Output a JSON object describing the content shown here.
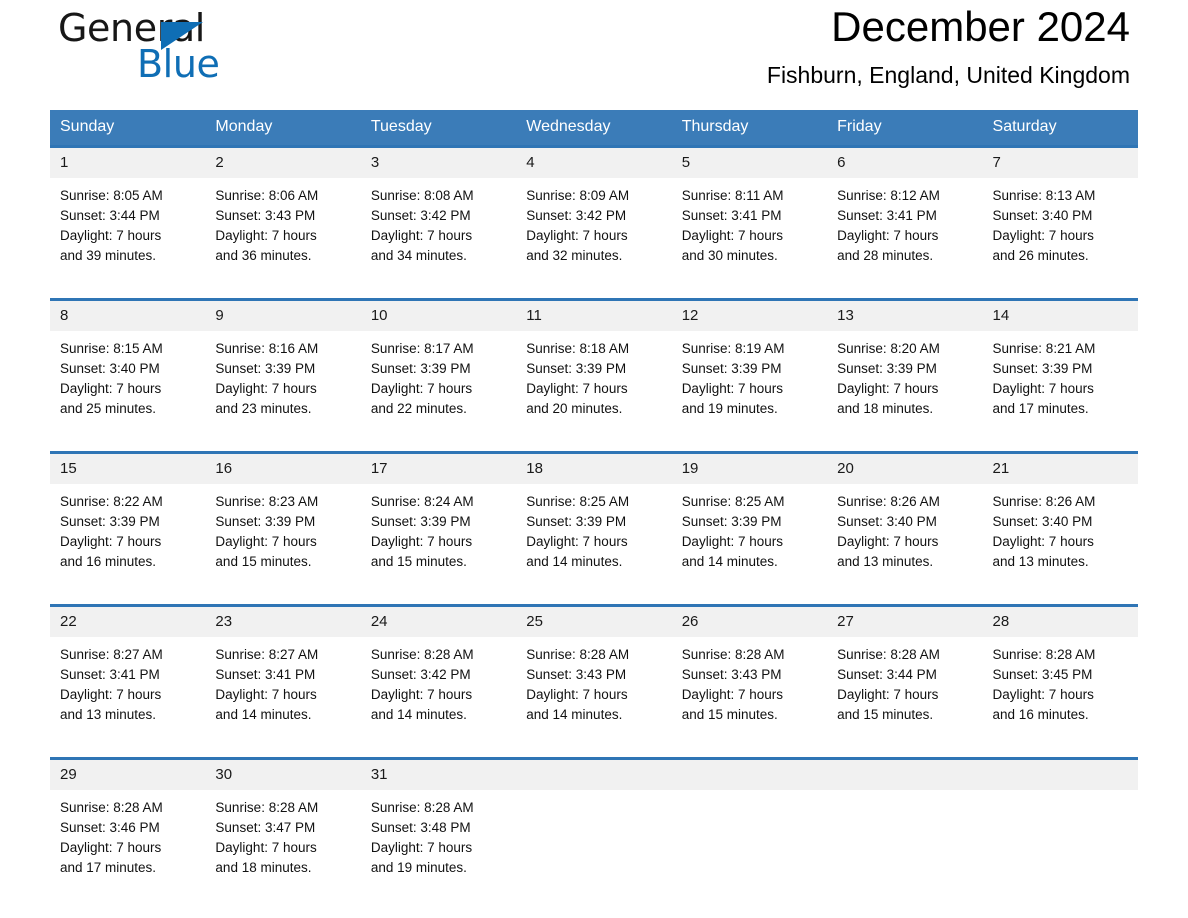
{
  "brand": {
    "name_part1": "General",
    "name_part2": "Blue",
    "accent_color": "#0F6EB5"
  },
  "header": {
    "title": "December 2024",
    "location": "Fishburn, England, United Kingdom",
    "header_bg": "#3B7CB8",
    "row_border_color": "#2F75B5",
    "daynum_bg": "#F1F1F1"
  },
  "weekday_headers": [
    "Sunday",
    "Monday",
    "Tuesday",
    "Wednesday",
    "Thursday",
    "Friday",
    "Saturday"
  ],
  "weeks": [
    [
      {
        "day": "1",
        "sunrise": "Sunrise: 8:05 AM",
        "sunset": "Sunset: 3:44 PM",
        "daylight_1": "Daylight: 7 hours",
        "daylight_2": "and 39 minutes."
      },
      {
        "day": "2",
        "sunrise": "Sunrise: 8:06 AM",
        "sunset": "Sunset: 3:43 PM",
        "daylight_1": "Daylight: 7 hours",
        "daylight_2": "and 36 minutes."
      },
      {
        "day": "3",
        "sunrise": "Sunrise: 8:08 AM",
        "sunset": "Sunset: 3:42 PM",
        "daylight_1": "Daylight: 7 hours",
        "daylight_2": "and 34 minutes."
      },
      {
        "day": "4",
        "sunrise": "Sunrise: 8:09 AM",
        "sunset": "Sunset: 3:42 PM",
        "daylight_1": "Daylight: 7 hours",
        "daylight_2": "and 32 minutes."
      },
      {
        "day": "5",
        "sunrise": "Sunrise: 8:11 AM",
        "sunset": "Sunset: 3:41 PM",
        "daylight_1": "Daylight: 7 hours",
        "daylight_2": "and 30 minutes."
      },
      {
        "day": "6",
        "sunrise": "Sunrise: 8:12 AM",
        "sunset": "Sunset: 3:41 PM",
        "daylight_1": "Daylight: 7 hours",
        "daylight_2": "and 28 minutes."
      },
      {
        "day": "7",
        "sunrise": "Sunrise: 8:13 AM",
        "sunset": "Sunset: 3:40 PM",
        "daylight_1": "Daylight: 7 hours",
        "daylight_2": "and 26 minutes."
      }
    ],
    [
      {
        "day": "8",
        "sunrise": "Sunrise: 8:15 AM",
        "sunset": "Sunset: 3:40 PM",
        "daylight_1": "Daylight: 7 hours",
        "daylight_2": "and 25 minutes."
      },
      {
        "day": "9",
        "sunrise": "Sunrise: 8:16 AM",
        "sunset": "Sunset: 3:39 PM",
        "daylight_1": "Daylight: 7 hours",
        "daylight_2": "and 23 minutes."
      },
      {
        "day": "10",
        "sunrise": "Sunrise: 8:17 AM",
        "sunset": "Sunset: 3:39 PM",
        "daylight_1": "Daylight: 7 hours",
        "daylight_2": "and 22 minutes."
      },
      {
        "day": "11",
        "sunrise": "Sunrise: 8:18 AM",
        "sunset": "Sunset: 3:39 PM",
        "daylight_1": "Daylight: 7 hours",
        "daylight_2": "and 20 minutes."
      },
      {
        "day": "12",
        "sunrise": "Sunrise: 8:19 AM",
        "sunset": "Sunset: 3:39 PM",
        "daylight_1": "Daylight: 7 hours",
        "daylight_2": "and 19 minutes."
      },
      {
        "day": "13",
        "sunrise": "Sunrise: 8:20 AM",
        "sunset": "Sunset: 3:39 PM",
        "daylight_1": "Daylight: 7 hours",
        "daylight_2": "and 18 minutes."
      },
      {
        "day": "14",
        "sunrise": "Sunrise: 8:21 AM",
        "sunset": "Sunset: 3:39 PM",
        "daylight_1": "Daylight: 7 hours",
        "daylight_2": "and 17 minutes."
      }
    ],
    [
      {
        "day": "15",
        "sunrise": "Sunrise: 8:22 AM",
        "sunset": "Sunset: 3:39 PM",
        "daylight_1": "Daylight: 7 hours",
        "daylight_2": "and 16 minutes."
      },
      {
        "day": "16",
        "sunrise": "Sunrise: 8:23 AM",
        "sunset": "Sunset: 3:39 PM",
        "daylight_1": "Daylight: 7 hours",
        "daylight_2": "and 15 minutes."
      },
      {
        "day": "17",
        "sunrise": "Sunrise: 8:24 AM",
        "sunset": "Sunset: 3:39 PM",
        "daylight_1": "Daylight: 7 hours",
        "daylight_2": "and 15 minutes."
      },
      {
        "day": "18",
        "sunrise": "Sunrise: 8:25 AM",
        "sunset": "Sunset: 3:39 PM",
        "daylight_1": "Daylight: 7 hours",
        "daylight_2": "and 14 minutes."
      },
      {
        "day": "19",
        "sunrise": "Sunrise: 8:25 AM",
        "sunset": "Sunset: 3:39 PM",
        "daylight_1": "Daylight: 7 hours",
        "daylight_2": "and 14 minutes."
      },
      {
        "day": "20",
        "sunrise": "Sunrise: 8:26 AM",
        "sunset": "Sunset: 3:40 PM",
        "daylight_1": "Daylight: 7 hours",
        "daylight_2": "and 13 minutes."
      },
      {
        "day": "21",
        "sunrise": "Sunrise: 8:26 AM",
        "sunset": "Sunset: 3:40 PM",
        "daylight_1": "Daylight: 7 hours",
        "daylight_2": "and 13 minutes."
      }
    ],
    [
      {
        "day": "22",
        "sunrise": "Sunrise: 8:27 AM",
        "sunset": "Sunset: 3:41 PM",
        "daylight_1": "Daylight: 7 hours",
        "daylight_2": "and 13 minutes."
      },
      {
        "day": "23",
        "sunrise": "Sunrise: 8:27 AM",
        "sunset": "Sunset: 3:41 PM",
        "daylight_1": "Daylight: 7 hours",
        "daylight_2": "and 14 minutes."
      },
      {
        "day": "24",
        "sunrise": "Sunrise: 8:28 AM",
        "sunset": "Sunset: 3:42 PM",
        "daylight_1": "Daylight: 7 hours",
        "daylight_2": "and 14 minutes."
      },
      {
        "day": "25",
        "sunrise": "Sunrise: 8:28 AM",
        "sunset": "Sunset: 3:43 PM",
        "daylight_1": "Daylight: 7 hours",
        "daylight_2": "and 14 minutes."
      },
      {
        "day": "26",
        "sunrise": "Sunrise: 8:28 AM",
        "sunset": "Sunset: 3:43 PM",
        "daylight_1": "Daylight: 7 hours",
        "daylight_2": "and 15 minutes."
      },
      {
        "day": "27",
        "sunrise": "Sunrise: 8:28 AM",
        "sunset": "Sunset: 3:44 PM",
        "daylight_1": "Daylight: 7 hours",
        "daylight_2": "and 15 minutes."
      },
      {
        "day": "28",
        "sunrise": "Sunrise: 8:28 AM",
        "sunset": "Sunset: 3:45 PM",
        "daylight_1": "Daylight: 7 hours",
        "daylight_2": "and 16 minutes."
      }
    ],
    [
      {
        "day": "29",
        "sunrise": "Sunrise: 8:28 AM",
        "sunset": "Sunset: 3:46 PM",
        "daylight_1": "Daylight: 7 hours",
        "daylight_2": "and 17 minutes."
      },
      {
        "day": "30",
        "sunrise": "Sunrise: 8:28 AM",
        "sunset": "Sunset: 3:47 PM",
        "daylight_1": "Daylight: 7 hours",
        "daylight_2": "and 18 minutes."
      },
      {
        "day": "31",
        "sunrise": "Sunrise: 8:28 AM",
        "sunset": "Sunset: 3:48 PM",
        "daylight_1": "Daylight: 7 hours",
        "daylight_2": "and 19 minutes."
      },
      {
        "day": "",
        "sunrise": "",
        "sunset": "",
        "daylight_1": "",
        "daylight_2": ""
      },
      {
        "day": "",
        "sunrise": "",
        "sunset": "",
        "daylight_1": "",
        "daylight_2": ""
      },
      {
        "day": "",
        "sunrise": "",
        "sunset": "",
        "daylight_1": "",
        "daylight_2": ""
      },
      {
        "day": "",
        "sunrise": "",
        "sunset": "",
        "daylight_1": "",
        "daylight_2": ""
      }
    ]
  ]
}
